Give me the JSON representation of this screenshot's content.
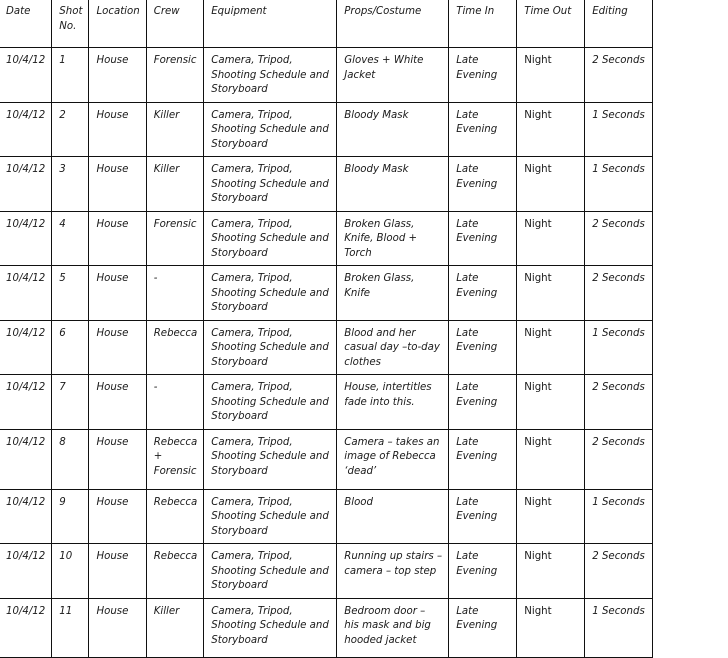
{
  "table": {
    "headers": [
      "Date",
      "Shot No.",
      "Location",
      "Crew",
      "Equipment",
      "Props/Costume",
      "Time In",
      "Time Out",
      "Editing"
    ],
    "rows": [
      {
        "date": "10/4/12",
        "shot": "1",
        "location": "House",
        "crew": "Forensic",
        "equipment": "Camera, Tripod, Shooting Schedule and Storyboard",
        "props": "Gloves + White Jacket",
        "time_in": "Late Evening",
        "time_out": "Night",
        "editing": "2 Seconds"
      },
      {
        "date": "10/4/12",
        "shot": "2",
        "location": "House",
        "crew": "Killer",
        "equipment": "Camera, Tripod, Shooting Schedule and Storyboard",
        "props": "Bloody Mask",
        "time_in": "Late Evening",
        "time_out": "Night",
        "editing": "1 Seconds"
      },
      {
        "date": "10/4/12",
        "shot": "3",
        "location": "House",
        "crew": "Killer",
        "equipment": "Camera, Tripod, Shooting Schedule and Storyboard",
        "props": "Bloody Mask",
        "time_in": "Late Evening",
        "time_out": "Night",
        "editing": "1 Seconds"
      },
      {
        "date": "10/4/12",
        "shot": "4",
        "location": "House",
        "crew": "Forensic",
        "equipment": "Camera, Tripod, Shooting Schedule and Storyboard",
        "props": "Broken Glass, Knife, Blood + Torch",
        "time_in": "Late Evening",
        "time_out": "Night",
        "editing": "2 Seconds"
      },
      {
        "date": "10/4/12",
        "shot": "5",
        "location": "House",
        "crew": "-",
        "equipment": "Camera, Tripod, Shooting Schedule and Storyboard",
        "props": "Broken Glass, Knife",
        "time_in": "Late Evening",
        "time_out": "Night",
        "editing": "2 Seconds"
      },
      {
        "date": "10/4/12",
        "shot": "6",
        "location": "House",
        "crew": "Rebecca",
        "equipment": "Camera, Tripod, Shooting Schedule and Storyboard",
        "props": "Blood and her casual day –to-day clothes",
        "time_in": "Late Evening",
        "time_out": "Night",
        "editing": "1 Seconds"
      },
      {
        "date": "10/4/12",
        "shot": "7",
        "location": "House",
        "crew": "-",
        "equipment": "Camera, Tripod, Shooting Schedule and Storyboard",
        "props": "House, intertitles fade into this.",
        "time_in": "Late Evening",
        "time_out": "Night",
        "editing": "2 Seconds"
      },
      {
        "date": "10/4/12",
        "shot": "8",
        "location": "House",
        "crew": "Rebecca + Forensic",
        "equipment": "Camera, Tripod, Shooting Schedule and Storyboard",
        "props": "Camera – takes an image of Rebecca ‘dead’",
        "time_in": "Late Evening",
        "time_out": "Night",
        "editing": "2 Seconds"
      },
      {
        "date": "10/4/12",
        "shot": "9",
        "location": "House",
        "crew": "Rebecca",
        "equipment": "Camera, Tripod, Shooting Schedule and Storyboard",
        "props": "Blood",
        "time_in": "Late Evening",
        "time_out": "Night",
        "editing": "1 Seconds"
      },
      {
        "date": "10/4/12",
        "shot": "10",
        "location": "House",
        "crew": "Rebecca",
        "equipment": "Camera, Tripod, Shooting Schedule and Storyboard",
        "props": "Running up stairs – camera – top step",
        "time_in": "Late Evening",
        "time_out": "Night",
        "editing": "2 Seconds"
      },
      {
        "date": "10/4/12",
        "shot": "11",
        "location": "House",
        "crew": "Killer",
        "equipment": "Camera, Tripod, Shooting Schedule and Storyboard",
        "props": "Bedroom door – his mask and big hooded jacket",
        "time_in": "Late Evening",
        "time_out": "Night",
        "editing": "1 Seconds"
      }
    ]
  }
}
